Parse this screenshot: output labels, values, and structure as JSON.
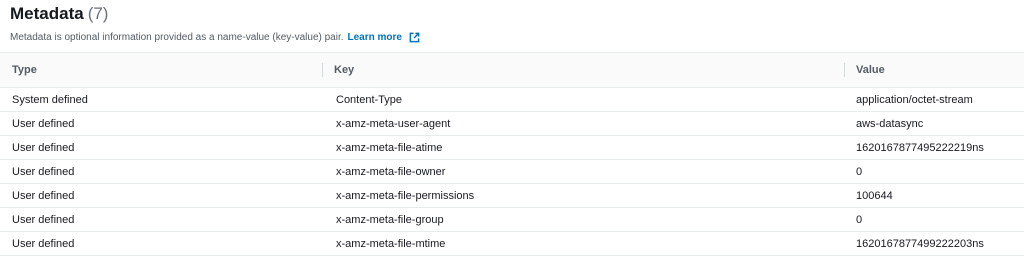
{
  "header": {
    "title": "Metadata",
    "count": "(7)",
    "description": "Metadata is optional information provided as a name-value (key-value) pair.",
    "learn_more": "Learn more",
    "external_icon": "external-link-icon",
    "link_color": "#0073bb"
  },
  "table": {
    "columns": [
      "Type",
      "Key",
      "Value"
    ],
    "rows": [
      {
        "type": "System defined",
        "key": "Content-Type",
        "value": "application/octet-stream"
      },
      {
        "type": "User defined",
        "key": "x-amz-meta-user-agent",
        "value": "aws-datasync"
      },
      {
        "type": "User defined",
        "key": "x-amz-meta-file-atime",
        "value": "1620167877495222219ns"
      },
      {
        "type": "User defined",
        "key": "x-amz-meta-file-owner",
        "value": "0"
      },
      {
        "type": "User defined",
        "key": "x-amz-meta-file-permissions",
        "value": "100644"
      },
      {
        "type": "User defined",
        "key": "x-amz-meta-file-group",
        "value": "0"
      },
      {
        "type": "User defined",
        "key": "x-amz-meta-file-mtime",
        "value": "1620167877499222203ns"
      }
    ]
  }
}
